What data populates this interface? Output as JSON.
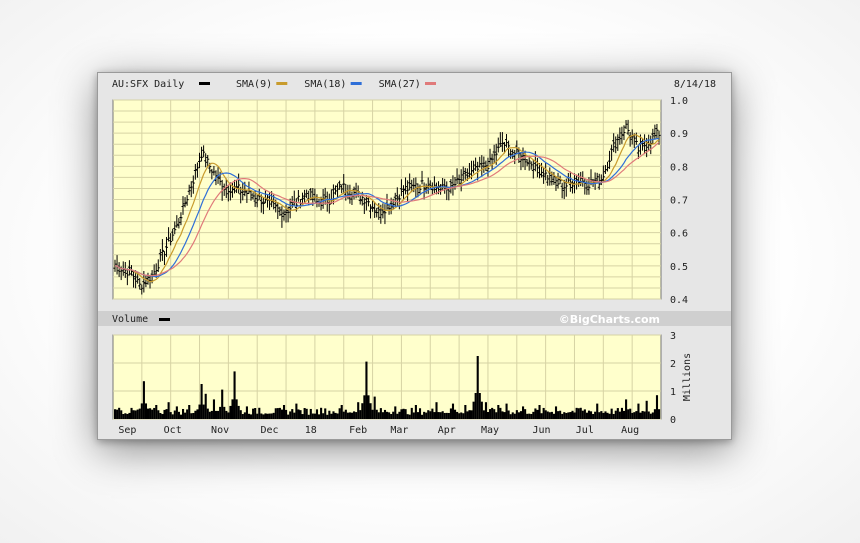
{
  "header": {
    "symbol": "AU:SFX Daily",
    "date": "8/14/18",
    "legend": [
      {
        "label": "SMA(9)",
        "color": "#c89b2d"
      },
      {
        "label": "SMA(18)",
        "color": "#2f6fd8"
      },
      {
        "label": "SMA(27)",
        "color": "#e07a7a"
      }
    ],
    "price_swatch_color": "#000000"
  },
  "volume_header": {
    "label": "Volume",
    "swatch_color": "#000000",
    "watermark": "©BigCharts.com"
  },
  "colors": {
    "plot_background": "#ffffcc",
    "grid": "#d6d3a4",
    "bar": "#000000"
  },
  "chart_data": [
    {
      "type": "ohlc-line",
      "title": "AU:SFX Daily",
      "ylim": [
        0.4,
        1.0
      ],
      "yticks": [
        "1.0",
        "0.9",
        "0.8",
        "0.7",
        "0.6",
        "0.5",
        "0.4"
      ],
      "x_month_labels": [
        "Sep",
        "Oct",
        "Nov",
        "Dec",
        "18",
        "Feb",
        "Mar",
        "Apr",
        "May",
        "Jun",
        "Jul",
        "Aug"
      ],
      "x_month_index": [
        6,
        28,
        51,
        75,
        95,
        118,
        138,
        161,
        182,
        207,
        228,
        250
      ],
      "total_days": 265,
      "price_anchors": [
        [
          0,
          0.5
        ],
        [
          8,
          0.48
        ],
        [
          12,
          0.44
        ],
        [
          18,
          0.47
        ],
        [
          22,
          0.52
        ],
        [
          26,
          0.57
        ],
        [
          30,
          0.62
        ],
        [
          34,
          0.69
        ],
        [
          38,
          0.76
        ],
        [
          42,
          0.84
        ],
        [
          47,
          0.79
        ],
        [
          52,
          0.74
        ],
        [
          60,
          0.73
        ],
        [
          68,
          0.71
        ],
        [
          76,
          0.68
        ],
        [
          82,
          0.66
        ],
        [
          88,
          0.69
        ],
        [
          93,
          0.72
        ],
        [
          98,
          0.69
        ],
        [
          104,
          0.7
        ],
        [
          110,
          0.74
        ],
        [
          116,
          0.72
        ],
        [
          122,
          0.7
        ],
        [
          128,
          0.66
        ],
        [
          134,
          0.69
        ],
        [
          140,
          0.73
        ],
        [
          146,
          0.74
        ],
        [
          152,
          0.75
        ],
        [
          158,
          0.73
        ],
        [
          164,
          0.74
        ],
        [
          170,
          0.77
        ],
        [
          176,
          0.79
        ],
        [
          182,
          0.81
        ],
        [
          188,
          0.87
        ],
        [
          194,
          0.84
        ],
        [
          200,
          0.82
        ],
        [
          206,
          0.79
        ],
        [
          212,
          0.76
        ],
        [
          218,
          0.74
        ],
        [
          224,
          0.76
        ],
        [
          230,
          0.75
        ],
        [
          236,
          0.76
        ],
        [
          242,
          0.86
        ],
        [
          248,
          0.92
        ],
        [
          254,
          0.85
        ],
        [
          260,
          0.88
        ],
        [
          264,
          0.9
        ]
      ],
      "series": [
        {
          "name": "SMA(9)",
          "window": 9,
          "color": "#c89b2d"
        },
        {
          "name": "SMA(18)",
          "window": 18,
          "color": "#2f6fd8"
        },
        {
          "name": "SMA(27)",
          "window": 27,
          "color": "#e07a7a"
        }
      ]
    },
    {
      "type": "area",
      "title": "Volume",
      "ylim": [
        0,
        3
      ],
      "yticks": [
        "3",
        "2",
        "1",
        "0"
      ],
      "ylabel": "Millions",
      "baseline": 0.15,
      "spikes": [
        [
          2,
          0.4
        ],
        [
          8,
          0.35
        ],
        [
          14,
          1.35
        ],
        [
          20,
          0.5
        ],
        [
          26,
          0.6
        ],
        [
          30,
          0.45
        ],
        [
          36,
          0.5
        ],
        [
          42,
          1.25
        ],
        [
          44,
          0.9
        ],
        [
          48,
          0.7
        ],
        [
          52,
          1.05
        ],
        [
          58,
          1.7
        ],
        [
          64,
          0.45
        ],
        [
          70,
          0.4
        ],
        [
          82,
          0.5
        ],
        [
          88,
          0.55
        ],
        [
          100,
          0.4
        ],
        [
          110,
          0.5
        ],
        [
          118,
          0.6
        ],
        [
          122,
          2.05
        ],
        [
          126,
          0.8
        ],
        [
          136,
          0.45
        ],
        [
          146,
          0.5
        ],
        [
          156,
          0.6
        ],
        [
          164,
          0.55
        ],
        [
          170,
          0.5
        ],
        [
          176,
          2.25
        ],
        [
          180,
          0.6
        ],
        [
          186,
          0.5
        ],
        [
          190,
          0.55
        ],
        [
          198,
          0.45
        ],
        [
          206,
          0.5
        ],
        [
          214,
          0.45
        ],
        [
          226,
          0.4
        ],
        [
          234,
          0.55
        ],
        [
          248,
          0.7
        ],
        [
          254,
          0.55
        ],
        [
          258,
          0.65
        ],
        [
          263,
          0.85
        ]
      ]
    }
  ]
}
